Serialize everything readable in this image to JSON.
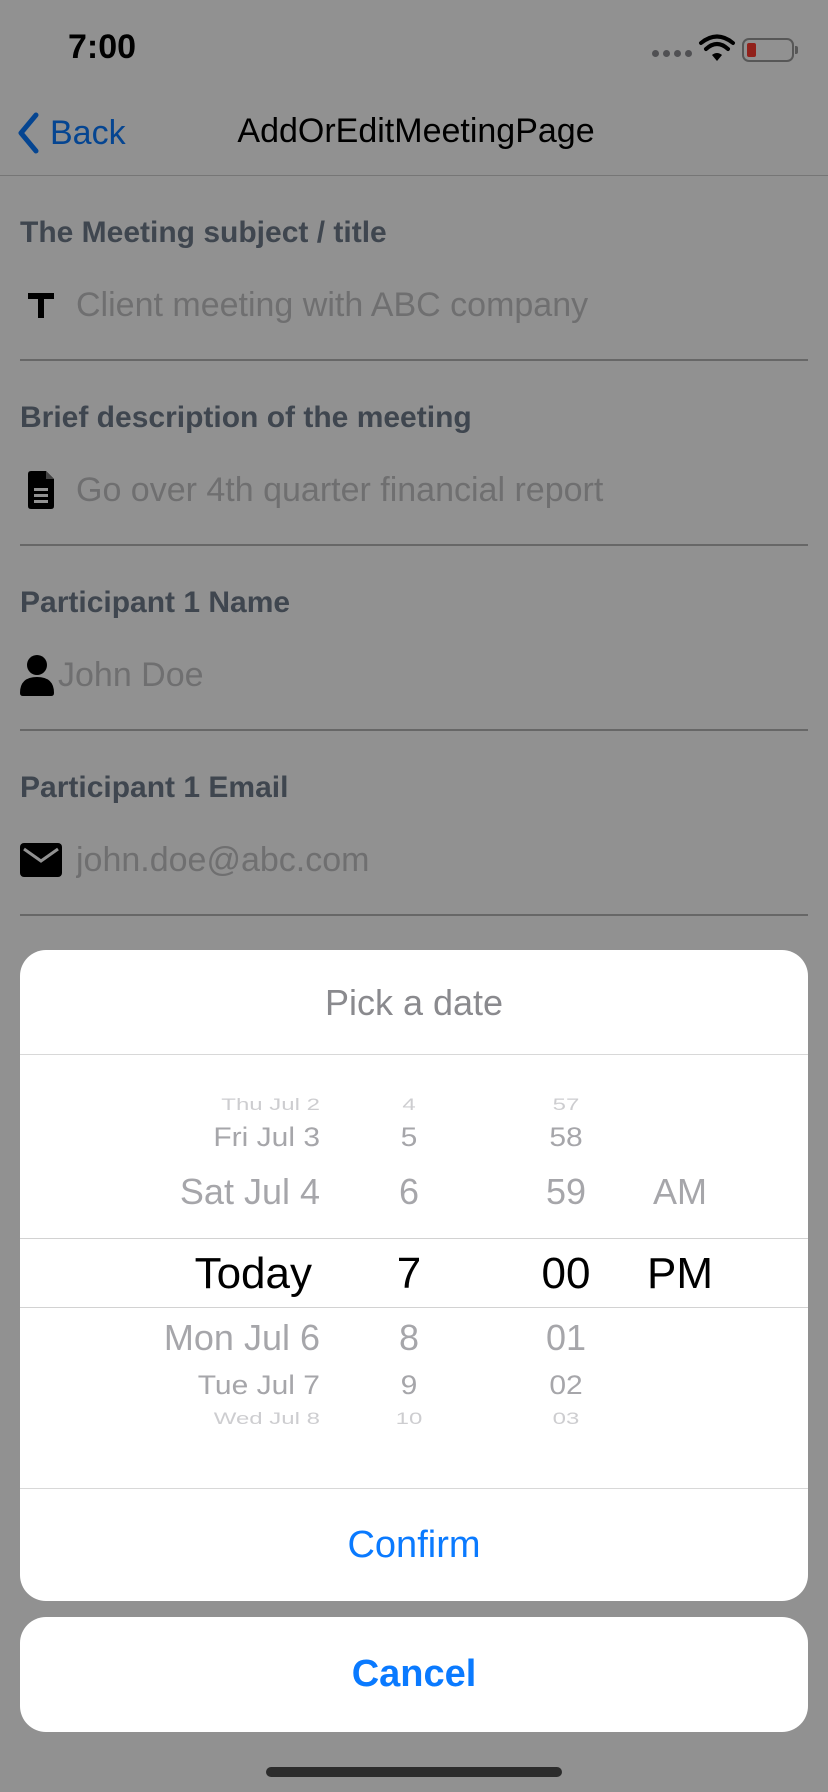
{
  "status_bar": {
    "time": "7:00"
  },
  "nav": {
    "back_label": "Back",
    "title": "AddOrEditMeetingPage"
  },
  "form": {
    "fields": [
      {
        "label": "The Meeting subject / title",
        "placeholder": "Client meeting with ABC company",
        "icon": "text-icon"
      },
      {
        "label": "Brief description of the meeting",
        "placeholder": "Go over 4th quarter financial report",
        "icon": "document-icon"
      },
      {
        "label": "Participant 1 Name",
        "placeholder": "John Doe",
        "icon": "person-icon"
      },
      {
        "label": "Participant 1 Email",
        "placeholder": "john.doe@abc.com",
        "icon": "envelope-icon"
      }
    ]
  },
  "picker": {
    "title": "Pick a date",
    "dates": [
      "Thu Jul 2",
      "Fri Jul 3",
      "Sat Jul 4",
      "Today",
      "Mon Jul 6",
      "Tue Jul 7",
      "Wed Jul 8"
    ],
    "hours": [
      "4",
      "5",
      "6",
      "7",
      "8",
      "9",
      "10"
    ],
    "minutes": [
      "57",
      "58",
      "59",
      "00",
      "01",
      "02",
      "03"
    ],
    "ampm": [
      "AM",
      "PM"
    ],
    "selected": {
      "date": "Today",
      "hour": "7",
      "minute": "00",
      "ampm": "PM"
    },
    "confirm_label": "Confirm",
    "cancel_label": "Cancel"
  },
  "colors": {
    "accent": "#0a7aff",
    "label": "#6f7c8c",
    "placeholder": "#c4c4c6",
    "battery_low": "#ff3b30"
  }
}
